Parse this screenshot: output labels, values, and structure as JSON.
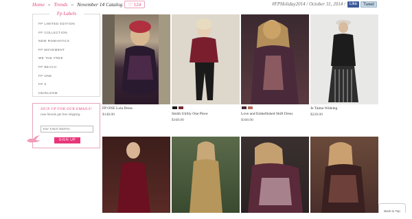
{
  "breadcrumb": {
    "home": "Home",
    "sep1": "»",
    "trends": "Trends",
    "sep2": "»",
    "current": "November 14 Catalog"
  },
  "like_count": "♡ 124",
  "hashtag": "#FPHoliday2014 / October 31, 2014 /",
  "social": {
    "facebook": "Like",
    "twitter": "Tweet"
  },
  "sidebar": {
    "title": "Fp Labels",
    "items": [
      "FP LIMITED EDITION",
      "FP COLLECTION",
      "NEW ROMANTICS",
      "FP MOVEMENT",
      "WE THE FREE",
      "FP BEACH",
      "FP ONE",
      "FP X",
      "HEIRLOOM"
    ]
  },
  "email": {
    "title": "SIGN UP FOR OUR EMAILS!",
    "subtitle": "new friends get free shipping",
    "placeholder": "Your Email Address",
    "button": "SIGN UP"
  },
  "products": [
    {
      "name": "FP ONE Lola Dress",
      "price": "$148.00",
      "swatches": []
    },
    {
      "name": "Smith Utility One Piece",
      "price": "$168.00",
      "swatches": [
        "#1a1a1a",
        "#7a2a2e"
      ]
    },
    {
      "name": "Love and Embellished Shift Dress",
      "price": "$168.00",
      "swatches": [
        "#4a2a3a",
        "#b86a5a"
      ]
    },
    {
      "name": "Je Taime Wideleg",
      "price": "$228.00",
      "swatches": []
    }
  ],
  "back_to_top": "Back to Top",
  "colors": {
    "accent": "#e0457b",
    "button": "#e8357a"
  }
}
